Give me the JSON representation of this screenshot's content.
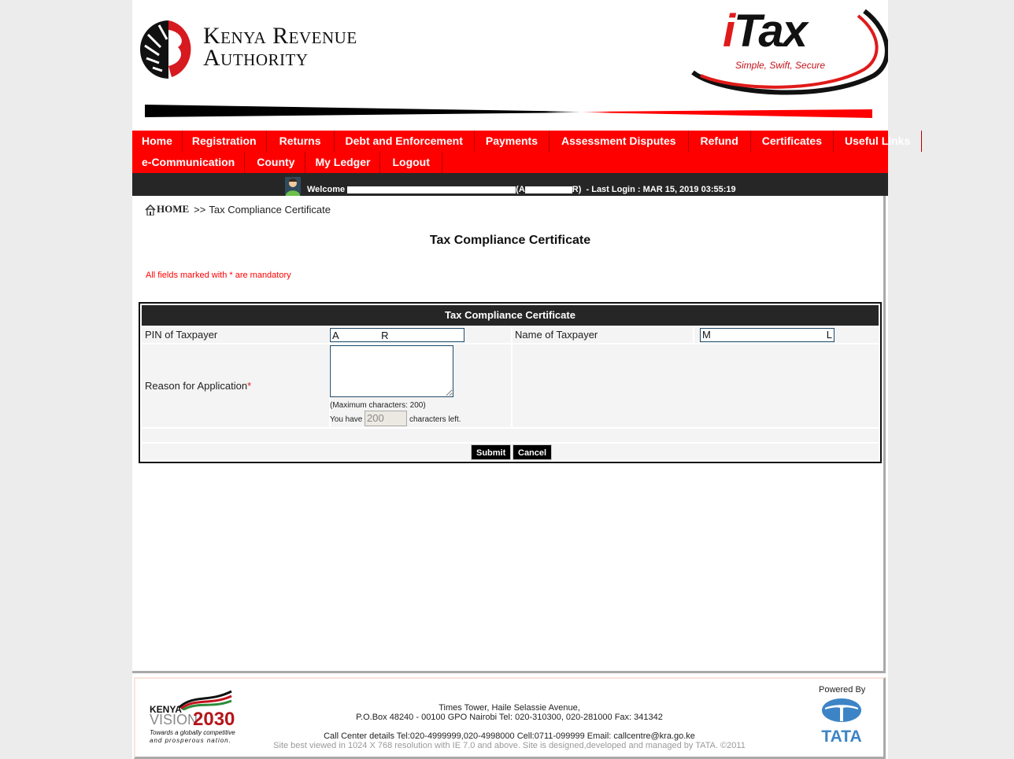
{
  "header": {
    "org_name_line1": "Kenya Revenue",
    "org_name_line2": "Authority",
    "itax_logo_text": "Tax",
    "itax_logo_i": "i",
    "itax_slogan": "Simple, Swift, Secure"
  },
  "nav": {
    "row1": [
      "Home",
      "Registration",
      "Returns",
      "Debt and Enforcement",
      "Payments",
      "Assessment Disputes",
      "Refund",
      "Certificates",
      "Useful Links"
    ],
    "row2": [
      "e-Communication",
      "County",
      "My Ledger",
      "Logout"
    ]
  },
  "welcome": {
    "prefix": "Welcome",
    "pin_start": "(A",
    "pin_end": "R)",
    "last_login": "- Last Login : MAR 15, 2019 03:55:19"
  },
  "breadcrumb": {
    "home": "HOME",
    "separator": ">>",
    "current": "Tax Compliance Certificate"
  },
  "page_title": "Tax Compliance Certificate",
  "mandatory_note": "All fields marked with * are mandatory",
  "form": {
    "header": "Tax Compliance Certificate",
    "pin_label": "PIN of Taxpayer",
    "pin_value": "A               R",
    "name_label": "Name of Taxpayer",
    "name_value": "M",
    "name_value_end": "L",
    "reason_label": "Reason for Application",
    "required_marker": "*",
    "reason_value": "",
    "max_chars_note": "(Maximum characters: 200)",
    "you_have": "You have",
    "chars_left_value": "200",
    "chars_left_suffix": "characters left.",
    "submit_label": "Submit",
    "cancel_label": "Cancel"
  },
  "footer": {
    "vision_kenya": "KENYA",
    "vision_word": "VISION",
    "vision_year": "2030",
    "vision_tagline1": "Towards a globally competitive",
    "vision_tagline2": "and prosperous nation.",
    "address_line1": "Times Tower, Haile Selassie Avenue,",
    "address_line2": "P.O.Box 48240 - 00100 GPO Nairobi Tel: 020-310300, 020-281000 Fax: 341342",
    "call_center": "Call Center details Tel:020-4999999,020-4998000 Cell:0711-099999 Email: callcentre@kra.go.ke",
    "site_note": "Site best viewed in 1024 X 768 resolution with IE 7.0 and above. Site is designed,developed and managed by TATA. ©2011",
    "powered_by": "Powered By",
    "tata": "TATA"
  },
  "colors": {
    "nav_red": "#ff0000",
    "dark_bar": "#262626",
    "mandatory_red": "#ff0000",
    "tata_blue": "#3c84c6"
  }
}
